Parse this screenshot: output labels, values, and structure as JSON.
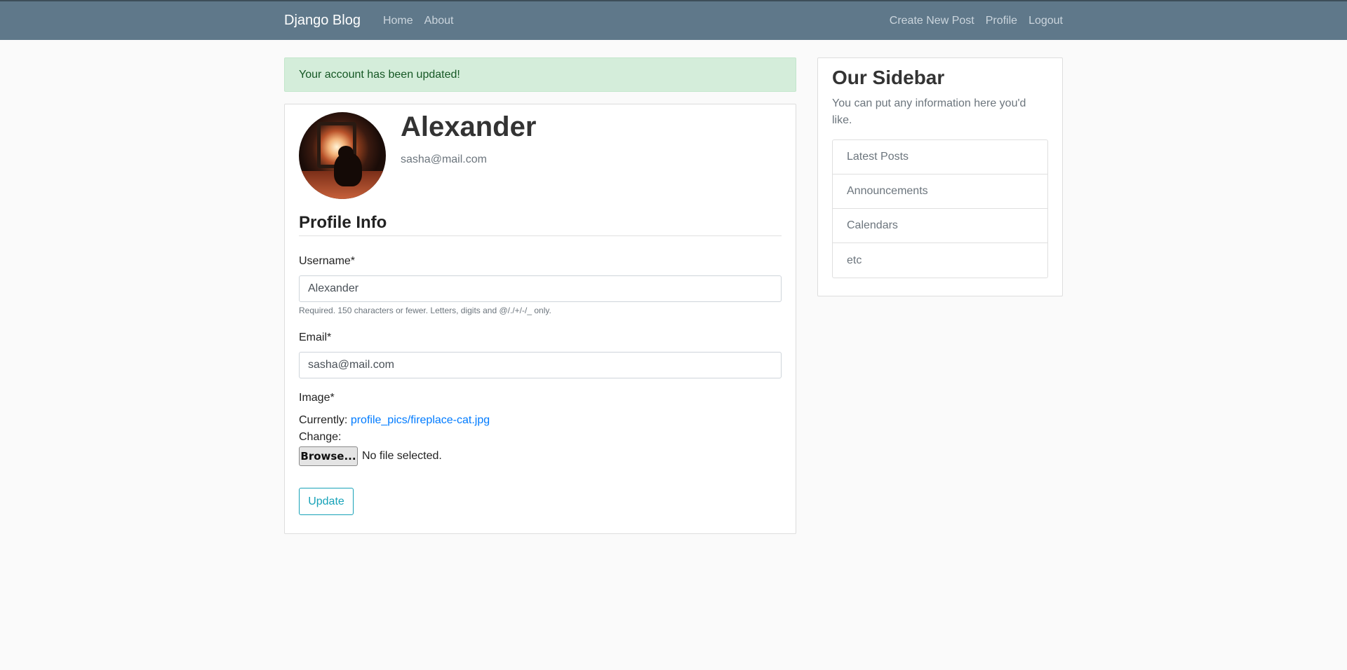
{
  "navbar": {
    "brand": "Django Blog",
    "left_links": [
      "Home",
      "About"
    ],
    "right_links": [
      "Create New Post",
      "Profile",
      "Logout"
    ]
  },
  "alert": {
    "message": "Your account has been updated!"
  },
  "profile": {
    "name": "Alexander",
    "email": "sasha@mail.com",
    "avatar": "fireplace-cat-photo"
  },
  "form": {
    "section_title": "Profile Info",
    "username_label": "Username*",
    "username_value": "Alexander",
    "username_help": "Required. 150 characters or fewer. Letters, digits and @/./+/-/_ only.",
    "email_label": "Email*",
    "email_value": "sasha@mail.com",
    "image_label": "Image*",
    "currently_label": "Currently:",
    "current_file": "profile_pics/fireplace-cat.jpg",
    "change_label": "Change:",
    "browse_label": "Browse...",
    "no_file_text": "No file selected.",
    "submit_label": "Update"
  },
  "sidebar": {
    "title": "Our Sidebar",
    "text": "You can put any information here you'd like.",
    "items": [
      "Latest Posts",
      "Announcements",
      "Calendars",
      "etc"
    ]
  },
  "colors": {
    "navbar": "#5f788a",
    "alert_bg": "#d4edda",
    "alert_text": "#155724",
    "link": "#007bff",
    "outline_button": "#17a2b8"
  }
}
